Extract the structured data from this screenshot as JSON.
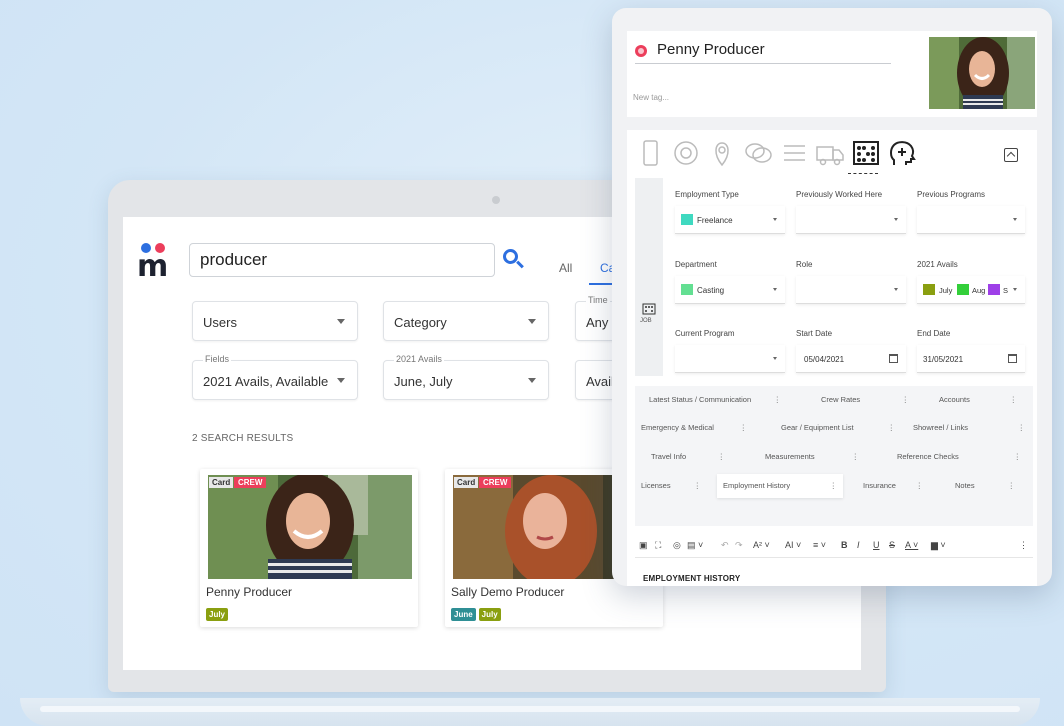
{
  "colors": {
    "accent_blue": "#2d6fe0",
    "brand_red": "#ec3e5b",
    "freelance_teal": "#3fd9c0",
    "casting_green": "#63df92",
    "july_olive": "#8a9f10",
    "june_teal": "#2f8f95",
    "aug_green": "#33cf3a",
    "purple": "#9e3fe8"
  },
  "app": {
    "search": {
      "value": "producer"
    },
    "tabs": {
      "all": "All",
      "partial": "Ca"
    },
    "filters": {
      "users": {
        "value": "Users"
      },
      "category": {
        "value": "Category"
      },
      "time": {
        "label": "Time",
        "value": "Any t"
      },
      "fields": {
        "label": "Fields",
        "value": "2021 Avails, Available"
      },
      "avails2021": {
        "label": "2021 Avails",
        "value": "June, July"
      },
      "avail_partial": {
        "value": "Avail"
      }
    },
    "results_count": "2 SEARCH RESULTS",
    "results": [
      {
        "tag_card": "Card",
        "tag_crew": "CREW",
        "name": "Penny Producer",
        "badges": [
          "July"
        ]
      },
      {
        "tag_card": "Card",
        "tag_crew": "CREW",
        "name": "Sally Demo Producer",
        "badges": [
          "June",
          "July"
        ]
      }
    ]
  },
  "panel": {
    "name": "Penny Producer",
    "new_tag_placeholder": "New tag...",
    "icons": [
      "phone-icon",
      "at-icon",
      "location-pin-icon",
      "chat-icon",
      "list-icon",
      "ambulance-icon",
      "abacus-job-icon",
      "head-plus-icon"
    ],
    "side_tab": {
      "label": "JOB"
    },
    "fields": {
      "employment_type": {
        "label": "Employment Type",
        "value": "Freelance"
      },
      "previously_worked": {
        "label": "Previously Worked Here",
        "value": ""
      },
      "previous_programs": {
        "label": "Previous Programs",
        "value": ""
      },
      "department": {
        "label": "Department",
        "value": "Casting"
      },
      "role": {
        "label": "Role",
        "value": ""
      },
      "avails_2021": {
        "label": "2021 Avails",
        "chips": [
          "July",
          "Aug",
          "S"
        ]
      },
      "current_program": {
        "label": "Current Program",
        "value": ""
      },
      "start_date": {
        "label": "Start Date",
        "value": "05/04/2021"
      },
      "end_date": {
        "label": "End Date",
        "value": "31/05/2021"
      }
    },
    "tabs": [
      "Latest Status / Communication",
      "Crew Rates",
      "Accounts",
      "Emergency & Medical",
      "Gear / Equipment List",
      "Showreel / Links",
      "Travel Info",
      "Measurements",
      "Reference Checks",
      "Licenses",
      "Employment History",
      "Insurance",
      "Notes"
    ],
    "more_glyph": "⋮",
    "toolbar": {
      "image": "▣",
      "fullscreen": "⛶",
      "link": "◎",
      "format": "▤ ˅",
      "undo": "↶",
      "redo": "↷",
      "font_size": "A² ˅",
      "font_case": "AI ˅",
      "align": "≡ ˅",
      "bold": "B",
      "italic": "I",
      "underline": "U",
      "strike": "S",
      "font_color": "A ˅",
      "bg_color": "▆ ˅",
      "more": "⋮"
    },
    "editor_title": "EMPLOYMENT HISTORY"
  }
}
